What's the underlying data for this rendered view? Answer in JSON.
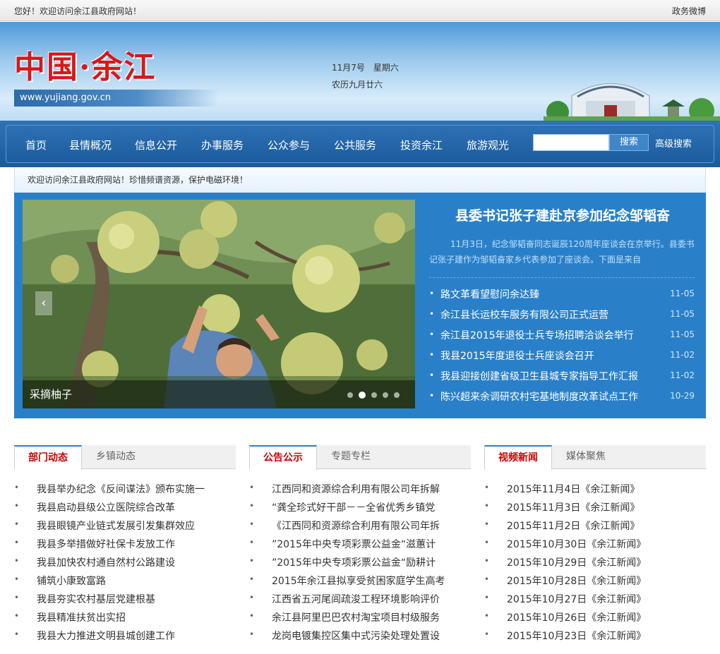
{
  "topbar": {
    "welcome": "您好！欢迎访问余江县政府网站！",
    "weibo": "政务微博"
  },
  "header": {
    "logo_text": "中国·余江",
    "logo_url": "www.yujiang.gov.cn",
    "date_line1": "11月7号　星期六",
    "date_line2": "农历九月廿六"
  },
  "nav": {
    "items": [
      "首页",
      "县情概况",
      "信息公开",
      "办事服务",
      "公众参与",
      "公共服务",
      "投资余江",
      "旅游观光"
    ],
    "search_placeholder": "",
    "search_button": "搜索",
    "advanced_search": "高级搜索"
  },
  "notice": "欢迎访问余江县政府网站！珍惜频谱资源，保护电磁环境！",
  "featured": {
    "slide_caption": "采摘柚子",
    "slide_count": 5,
    "active_slide": 2,
    "headline": "县委书记张子建赴京参加纪念邹韬奋",
    "summary": "11月3日，纪念邹韬奋同志诞辰120周年座谈会在京举行。县委书记张子建作为邹韬奋家乡代表参加了座谈会。下面是来自",
    "news": [
      {
        "title": "路文革看望慰问余达臻",
        "date": "11-05"
      },
      {
        "title": "余江县长运校车服务有限公司正式运营",
        "date": "11-05"
      },
      {
        "title": "余江县2015年退役士兵专场招聘洽谈会举行",
        "date": "11-05"
      },
      {
        "title": "我县2015年度退役士兵座谈会召开",
        "date": "11-02"
      },
      {
        "title": "我县迎接创建省级卫生县城专家指导工作汇报",
        "date": "11-02"
      },
      {
        "title": "陈兴超来余调研农村宅基地制度改革试点工作",
        "date": "10-29"
      }
    ]
  },
  "columns": [
    {
      "tab_active": "部门动态",
      "tab_inactive": "乡镇动态",
      "items": [
        "我县举办纪念《反间谍法》颁布实施一",
        "我县启动县级公立医院综合改革",
        "我县眼镜产业链式发展引发集群效应",
        "我县多举措做好社保卡发放工作",
        "我县加快农村通自然村公路建设",
        "铺筑小康致富路",
        "我县夯实农村基层党建根基",
        "我县精准扶贫出实招",
        "我县大力推进文明县城创建工作"
      ]
    },
    {
      "tab_active": "公告公示",
      "tab_inactive": "专题专栏",
      "items": [
        "江西同和资源综合利用有限公司年拆解",
        "“龚全珍式好干部－－全省优秀乡镇党",
        "《江西同和资源综合利用有限公司年拆",
        "”2015年中央专项彩票公益金“滋蕙计",
        "”2015年中央专项彩票公益金“励耕计",
        "2015年余江县拟享受贫困家庭学生高考",
        "江西省五河尾闾疏浚工程环境影响评价",
        "余江县阿里巴巴农村淘宝项目村级服务",
        "龙岗电镀集控区集中式污染处理处置设"
      ]
    },
    {
      "tab_active": "视频新闻",
      "tab_inactive": "媒体聚焦",
      "items": [
        "2015年11月4日《余江新闻》",
        "2015年11月3日《余江新闻》",
        "2015年11月2日《余江新闻》",
        "2015年10月30日《余江新闻》",
        "2015年10月29日《余江新闻》",
        "2015年10月28日《余江新闻》",
        "2015年10月27日《余江新闻》",
        "2015年10月26日《余江新闻》",
        "2015年10月23日《余江新闻》"
      ]
    }
  ],
  "colors": {
    "brand_blue": "#2a80c8",
    "nav_blue": "#1f63a8",
    "accent_red": "#cc0000",
    "logo_red": "#d8171c"
  },
  "icons": {
    "bullet": "•",
    "slide_prev": "chevron-left-icon"
  }
}
